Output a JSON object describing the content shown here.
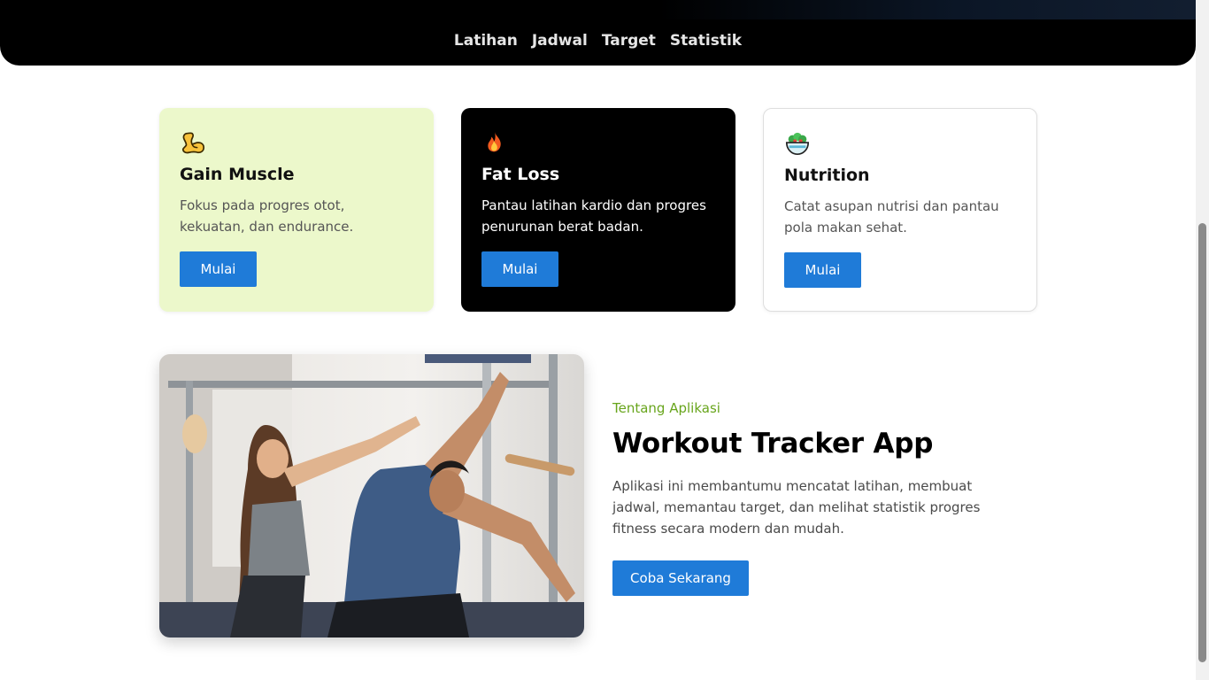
{
  "nav": {
    "items": [
      "Latihan",
      "Jadwal",
      "Target",
      "Statistik"
    ]
  },
  "cards": [
    {
      "icon": "flexed-biceps-icon",
      "title": "Gain Muscle",
      "description": "Fokus pada progres otot, kekuatan, dan endurance.",
      "button": "Mulai",
      "background": "#ecf8cb"
    },
    {
      "icon": "fire-icon",
      "title": "Fat Loss",
      "description": "Pantau latihan kardio dan progres penurunan berat badan.",
      "button": "Mulai",
      "background": "#000000"
    },
    {
      "icon": "salad-bowl-icon",
      "title": "Nutrition",
      "description": "Catat asupan nutrisi dan pantau pola makan sehat.",
      "button": "Mulai",
      "background": "#ffffff"
    }
  ],
  "about": {
    "eyebrow": "Tentang Aplikasi",
    "title": "Workout Tracker App",
    "description": "Aplikasi ini membantumu mencatat latihan, membuat jadwal, memantau target, dan melihat statistik progres fitness secara modern dan mudah.",
    "button": "Coba Sekarang"
  },
  "colors": {
    "accent": "#1f7bd8",
    "eyebrow": "#68a51c",
    "header": "#000000"
  }
}
